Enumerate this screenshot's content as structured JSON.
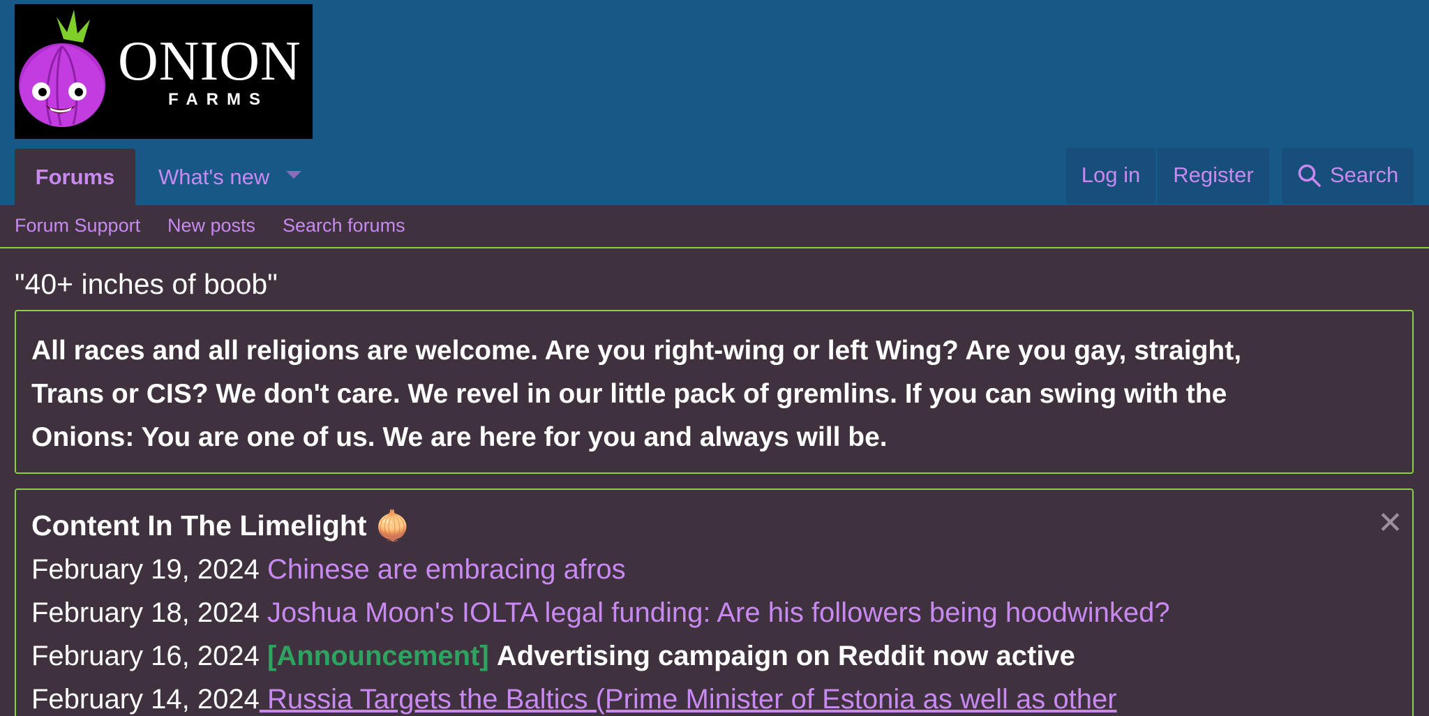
{
  "logo": {
    "word": "ONION",
    "sub": "FARMS"
  },
  "nav": {
    "tabs": [
      {
        "label": "Forums"
      },
      {
        "label": "What's new"
      }
    ],
    "login": "Log in",
    "register": "Register",
    "search": "Search"
  },
  "subnav": [
    {
      "label": "Forum Support"
    },
    {
      "label": "New posts"
    },
    {
      "label": "Search forums"
    }
  ],
  "page_title": "\"40+ inches of boob\"",
  "notice": {
    "line1": "All races and all religions are welcome. Are you right-wing or left Wing? Are you gay, straight,",
    "line2": "Trans or CIS? We don't care. We revel in our little pack of gremlins. If you can swing with the",
    "line3": "Onions: You are one of us. We are here for you and always will be."
  },
  "limelight": {
    "title": "Content In The Limelight 🧅",
    "close": "✕",
    "rows": [
      {
        "date": "February 19, 2024",
        "link": "Chinese are embracing afros"
      },
      {
        "date": "February 18, 2024",
        "link": "Joshua Moon's IOLTA legal funding: Are his followers being hoodwinked?"
      },
      {
        "date": "February 16, 2024",
        "tag": "[Announcement]",
        "text": "Advertising campaign on Reddit now active"
      },
      {
        "date": "February 14, 2024",
        "link": " Russia Targets the Baltics (Prime Minister of Estonia as well as other"
      }
    ]
  },
  "colors": {
    "header": "#185887",
    "body": "#3f323e",
    "accent_link": "#c889f1",
    "border": "#8dcf43",
    "announcement": "#2ea35f"
  }
}
